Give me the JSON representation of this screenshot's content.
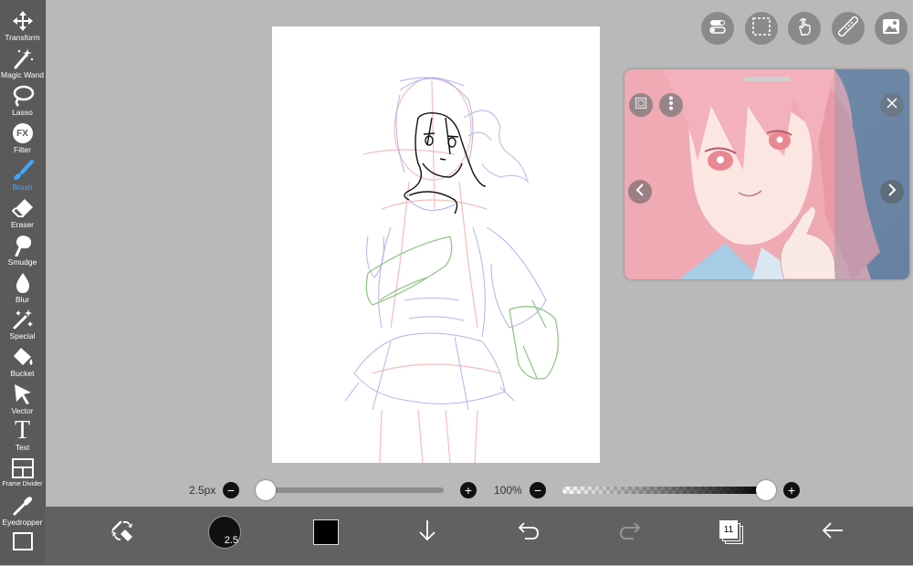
{
  "tools": [
    {
      "id": "transform",
      "label": "Transform",
      "icon": "move-arrows-icon"
    },
    {
      "id": "magic-wand",
      "label": "Magic Wand",
      "icon": "magic-wand-icon"
    },
    {
      "id": "lasso",
      "label": "Lasso",
      "icon": "lasso-icon"
    },
    {
      "id": "filter",
      "label": "Filter",
      "icon": "fx-icon",
      "glyph": "FX"
    },
    {
      "id": "brush",
      "label": "Brush",
      "icon": "brush-icon",
      "active": true
    },
    {
      "id": "eraser",
      "label": "Eraser",
      "icon": "eraser-icon"
    },
    {
      "id": "smudge",
      "label": "Smudge",
      "icon": "smudge-icon"
    },
    {
      "id": "blur",
      "label": "Blur",
      "icon": "blur-drop-icon"
    },
    {
      "id": "special",
      "label": "Special",
      "icon": "special-wand-icon"
    },
    {
      "id": "bucket",
      "label": "Bucket",
      "icon": "bucket-icon"
    },
    {
      "id": "vector",
      "label": "Vector",
      "icon": "vector-cursor-icon"
    },
    {
      "id": "text",
      "label": "Text",
      "icon": "text-icon",
      "glyph": "T"
    },
    {
      "id": "frame-divider",
      "label": "Frame Divider",
      "icon": "frame-divider-icon"
    },
    {
      "id": "eyedropper",
      "label": "Eyedropper",
      "icon": "eyedropper-icon"
    },
    {
      "id": "canvas",
      "label": "",
      "icon": "canvas-icon"
    }
  ],
  "top_buttons": [
    "toggle-icon",
    "selection-icon",
    "hand-gesture-icon",
    "ruler-icon",
    "image-icon"
  ],
  "brush": {
    "size_label": "2.5px",
    "size_fraction": 0.0,
    "opacity_label": "100%",
    "opacity_fraction": 1.0,
    "minus": "−",
    "plus": "+"
  },
  "bottom": {
    "brush_size_badge": "2.5",
    "color": "#000000",
    "layer_count": "11"
  },
  "colors": {
    "accent": "#41a6ff",
    "sidebar": "#5a5a5a",
    "bottombar": "#616161",
    "workspace": "#b9b9b9"
  }
}
